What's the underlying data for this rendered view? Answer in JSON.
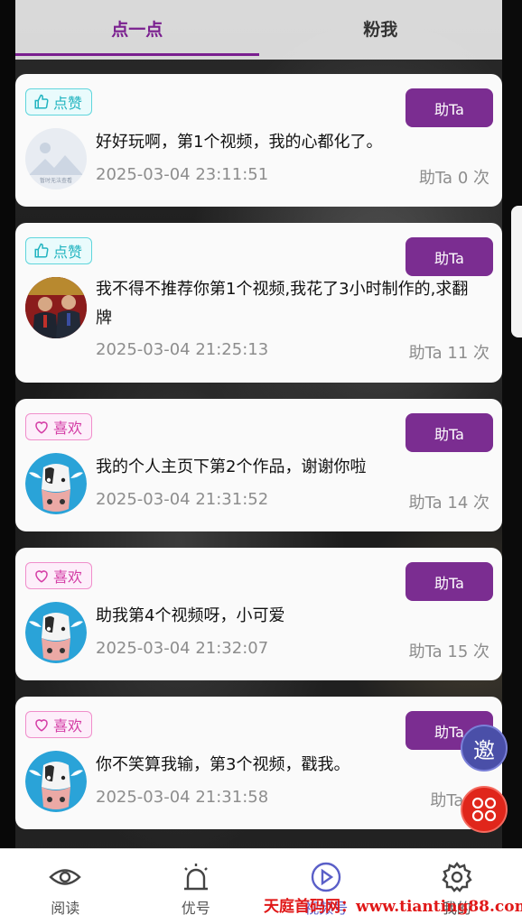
{
  "tabs": [
    {
      "label": "点一点"
    },
    {
      "label": "粉我"
    }
  ],
  "help_label": "助Ta",
  "cards": [
    {
      "badge": "点赞",
      "badge_type": "like",
      "avatar": "placeholder",
      "avatar_text": "暂时无法查看",
      "message": "好好玩啊，第1个视频，我的心都化了。",
      "time": "2025-03-04 23:11:51",
      "count": "助Ta 0 次"
    },
    {
      "badge": "点赞",
      "badge_type": "like",
      "avatar": "people",
      "message": "我不得不推荐你第1个视频,我花了3小时制作的,求翻牌",
      "time": "2025-03-04 21:25:13",
      "count": "助Ta 11 次"
    },
    {
      "badge": "喜欢",
      "badge_type": "fav",
      "avatar": "cow",
      "message": "我的个人主页下第2个作品，谢谢你啦",
      "time": "2025-03-04 21:31:52",
      "count": "助Ta 14 次"
    },
    {
      "badge": "喜欢",
      "badge_type": "fav",
      "avatar": "cow",
      "message": "助我第4个视频呀，小可爱",
      "time": "2025-03-04 21:32:07",
      "count": "助Ta 15 次"
    },
    {
      "badge": "喜欢",
      "badge_type": "fav",
      "avatar": "cow",
      "message": "你不笑算我输，第3个视频，戳我。",
      "time": "2025-03-04 21:31:58",
      "count": "助Ta 15"
    }
  ],
  "float": {
    "invite": "邀"
  },
  "bottom_nav": [
    {
      "label": "阅读",
      "icon": "eye-icon"
    },
    {
      "label": "优号",
      "icon": "alarm-icon"
    },
    {
      "label": "视频号",
      "icon": "play-icon"
    },
    {
      "label": "我的",
      "icon": "gear-icon"
    }
  ],
  "watermark": "天庭首码网：www.tianting88.com"
}
